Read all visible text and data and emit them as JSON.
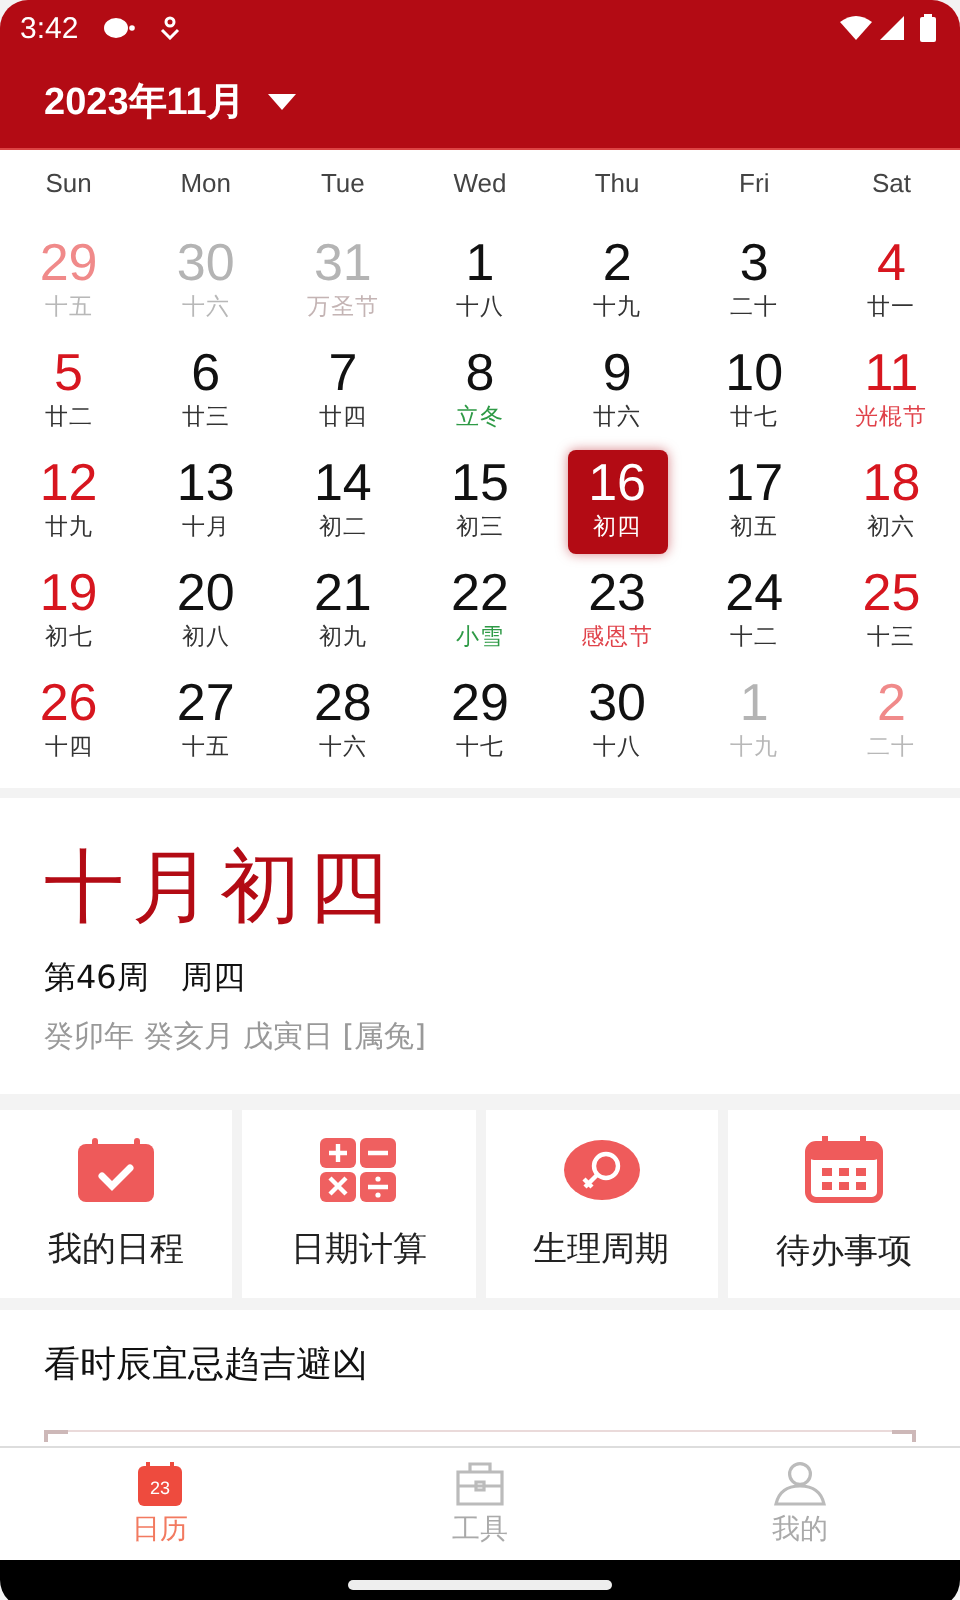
{
  "status_bar": {
    "time": "3:42"
  },
  "header": {
    "title": "2023年11月"
  },
  "weekdays": [
    "Sun",
    "Mon",
    "Tue",
    "Wed",
    "Thu",
    "Fri",
    "Sat"
  ],
  "days": [
    {
      "day": "29",
      "sub": "十五",
      "other_month": true,
      "weekend": true,
      "kind": "lunar",
      "selected": false
    },
    {
      "day": "30",
      "sub": "十六",
      "other_month": true,
      "weekend": false,
      "kind": "lunar",
      "selected": false
    },
    {
      "day": "31",
      "sub": "万圣节",
      "other_month": true,
      "weekend": false,
      "kind": "festival",
      "selected": false
    },
    {
      "day": "1",
      "sub": "十八",
      "other_month": false,
      "weekend": false,
      "kind": "lunar",
      "selected": false
    },
    {
      "day": "2",
      "sub": "十九",
      "other_month": false,
      "weekend": false,
      "kind": "lunar",
      "selected": false
    },
    {
      "day": "3",
      "sub": "二十",
      "other_month": false,
      "weekend": false,
      "kind": "lunar",
      "selected": false
    },
    {
      "day": "4",
      "sub": "廿一",
      "other_month": false,
      "weekend": true,
      "kind": "lunar",
      "selected": false
    },
    {
      "day": "5",
      "sub": "廿二",
      "other_month": false,
      "weekend": true,
      "kind": "lunar",
      "selected": false
    },
    {
      "day": "6",
      "sub": "廿三",
      "other_month": false,
      "weekend": false,
      "kind": "lunar",
      "selected": false
    },
    {
      "day": "7",
      "sub": "廿四",
      "other_month": false,
      "weekend": false,
      "kind": "lunar",
      "selected": false
    },
    {
      "day": "8",
      "sub": "立冬",
      "other_month": false,
      "weekend": false,
      "kind": "term",
      "selected": false
    },
    {
      "day": "9",
      "sub": "廿六",
      "other_month": false,
      "weekend": false,
      "kind": "lunar",
      "selected": false
    },
    {
      "day": "10",
      "sub": "廿七",
      "other_month": false,
      "weekend": false,
      "kind": "lunar",
      "selected": false
    },
    {
      "day": "11",
      "sub": "光棍节",
      "other_month": false,
      "weekend": true,
      "kind": "festival",
      "selected": false
    },
    {
      "day": "12",
      "sub": "廿九",
      "other_month": false,
      "weekend": true,
      "kind": "lunar",
      "selected": false
    },
    {
      "day": "13",
      "sub": "十月",
      "other_month": false,
      "weekend": false,
      "kind": "lunar",
      "selected": false
    },
    {
      "day": "14",
      "sub": "初二",
      "other_month": false,
      "weekend": false,
      "kind": "lunar",
      "selected": false
    },
    {
      "day": "15",
      "sub": "初三",
      "other_month": false,
      "weekend": false,
      "kind": "lunar",
      "selected": false
    },
    {
      "day": "16",
      "sub": "初四",
      "kind": "lunar",
      "selected": true
    },
    {
      "day": "17",
      "sub": "初五",
      "other_month": false,
      "weekend": false,
      "kind": "lunar",
      "selected": false
    },
    {
      "day": "18",
      "sub": "初六",
      "other_month": false,
      "weekend": true,
      "kind": "lunar",
      "selected": false
    },
    {
      "day": "19",
      "sub": "初七",
      "other_month": false,
      "weekend": true,
      "kind": "lunar",
      "selected": false
    },
    {
      "day": "20",
      "sub": "初八",
      "other_month": false,
      "weekend": false,
      "kind": "lunar",
      "selected": false
    },
    {
      "day": "21",
      "sub": "初九",
      "other_month": false,
      "weekend": false,
      "kind": "lunar",
      "selected": false
    },
    {
      "day": "22",
      "sub": "小雪",
      "other_month": false,
      "weekend": false,
      "kind": "term",
      "selected": false
    },
    {
      "day": "23",
      "sub": "感恩节",
      "other_month": false,
      "weekend": false,
      "kind": "festival",
      "selected": false
    },
    {
      "day": "24",
      "sub": "十二",
      "other_month": false,
      "weekend": false,
      "kind": "lunar",
      "selected": false
    },
    {
      "day": "25",
      "sub": "十三",
      "other_month": false,
      "weekend": true,
      "kind": "lunar",
      "selected": false
    },
    {
      "day": "26",
      "sub": "十四",
      "other_month": false,
      "weekend": true,
      "kind": "lunar",
      "selected": false
    },
    {
      "day": "27",
      "sub": "十五",
      "other_month": false,
      "weekend": false,
      "kind": "lunar",
      "selected": false
    },
    {
      "day": "28",
      "sub": "十六",
      "other_month": false,
      "weekend": false,
      "kind": "lunar",
      "selected": false
    },
    {
      "day": "29",
      "sub": "十七",
      "other_month": false,
      "weekend": false,
      "kind": "lunar",
      "selected": false
    },
    {
      "day": "30",
      "sub": "十八",
      "other_month": false,
      "weekend": false,
      "kind": "lunar",
      "selected": false
    },
    {
      "day": "1",
      "sub": "十九",
      "other_month": true,
      "weekend": false,
      "kind": "lunar",
      "selected": false
    },
    {
      "day": "2",
      "sub": "二十",
      "other_month": true,
      "weekend": true,
      "kind": "lunar",
      "selected": false
    }
  ],
  "lunar_info": {
    "lunar_date": "十月初四",
    "week": "第46周",
    "weekday": "周四",
    "ganzhi": "癸卯年 癸亥月 戊寅日 [属兔]"
  },
  "tools": [
    {
      "kind": "schedule",
      "label": "我的日程"
    },
    {
      "kind": "calculator",
      "label": "日期计算"
    },
    {
      "kind": "cycle",
      "label": "生理周期"
    },
    {
      "kind": "todo",
      "label": "待办事项"
    }
  ],
  "fortune": {
    "title": "看时辰宜忌趋吉避凶"
  },
  "tab_bar": [
    {
      "kind": "calendar",
      "label": "日历",
      "icon_text": "23",
      "selected": true
    },
    {
      "kind": "tools",
      "label": "工具",
      "selected": false
    },
    {
      "kind": "me",
      "label": "我的",
      "selected": false
    }
  ]
}
